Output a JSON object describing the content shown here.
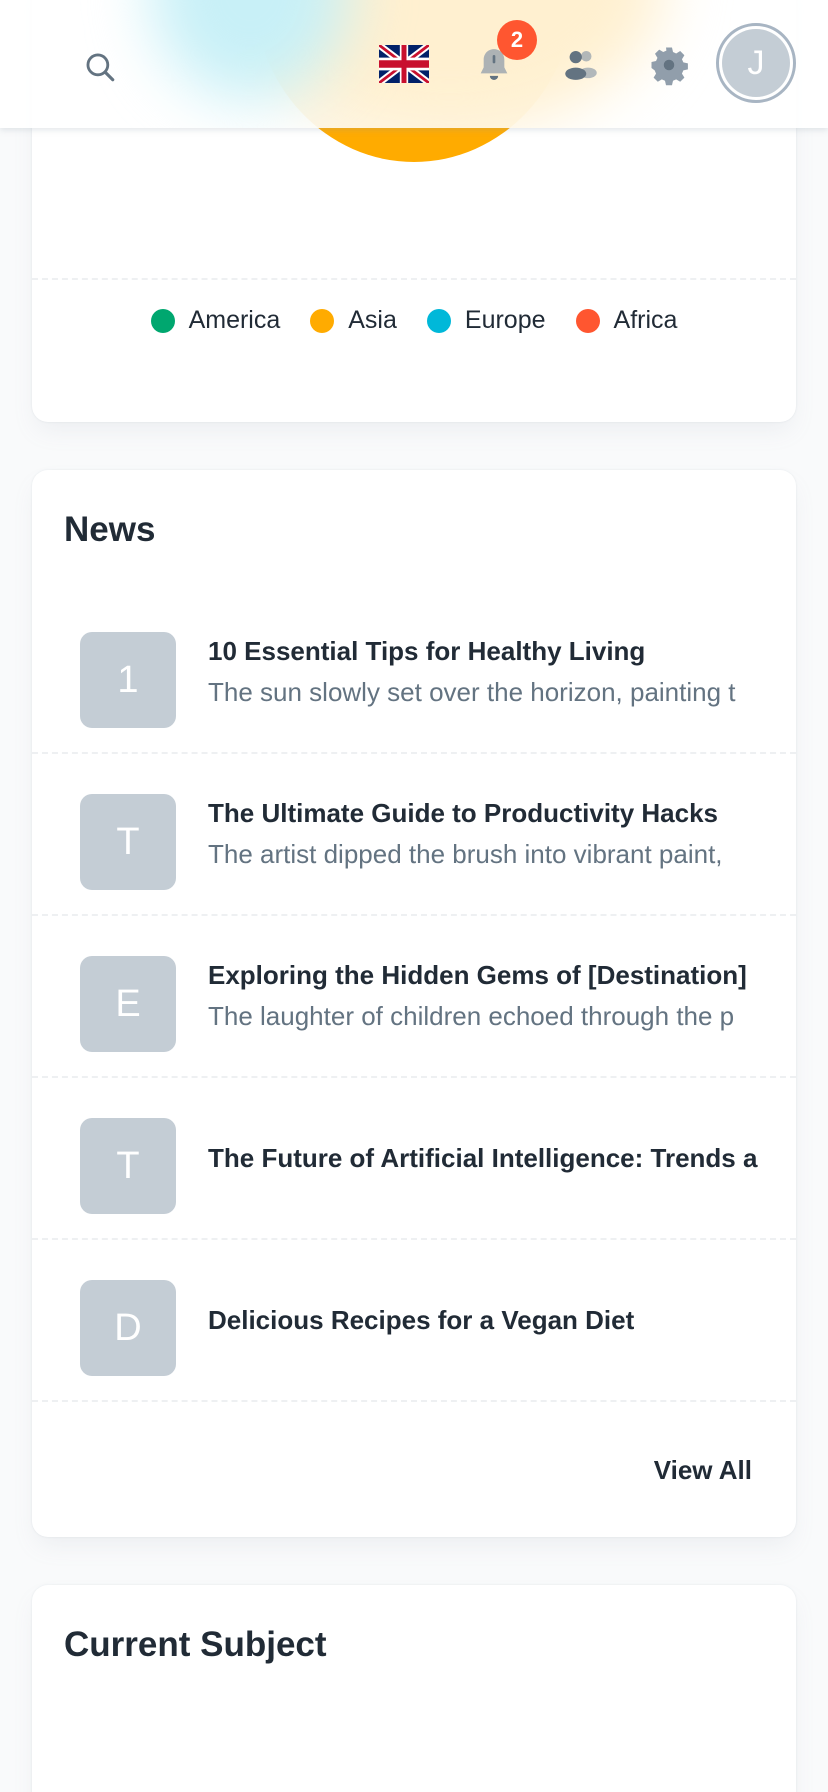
{
  "header": {
    "notification_count": "2",
    "avatar_initial": "J",
    "icons": [
      "search-icon",
      "uk-flag-icon",
      "bell-icon",
      "contacts-icon",
      "gear-icon"
    ]
  },
  "pie_chart": {
    "legend": [
      {
        "label": "America",
        "color": "#00a76f"
      },
      {
        "label": "Asia",
        "color": "#ffab00"
      },
      {
        "label": "Europe",
        "color": "#00b8d9"
      },
      {
        "label": "Africa",
        "color": "#ff5630"
      }
    ]
  },
  "news": {
    "title": "News",
    "items": [
      {
        "initial": "1",
        "title": "10 Essential Tips for Healthy Living",
        "description": "The sun slowly set over the horizon, painting t"
      },
      {
        "initial": "T",
        "title": "The Ultimate Guide to Productivity Hacks",
        "description": "The artist dipped the brush into vibrant paint,"
      },
      {
        "initial": "E",
        "title": "Exploring the Hidden Gems of [Destination]",
        "description": "The laughter of children echoed through the p"
      },
      {
        "initial": "T",
        "title": "The Future of Artificial Intelligence: Trends a",
        "description": ""
      },
      {
        "initial": "D",
        "title": "Delicious Recipes for a Vegan Diet",
        "description": ""
      }
    ],
    "view_all_label": "View All"
  },
  "current_subject": {
    "title": "Current Subject"
  }
}
